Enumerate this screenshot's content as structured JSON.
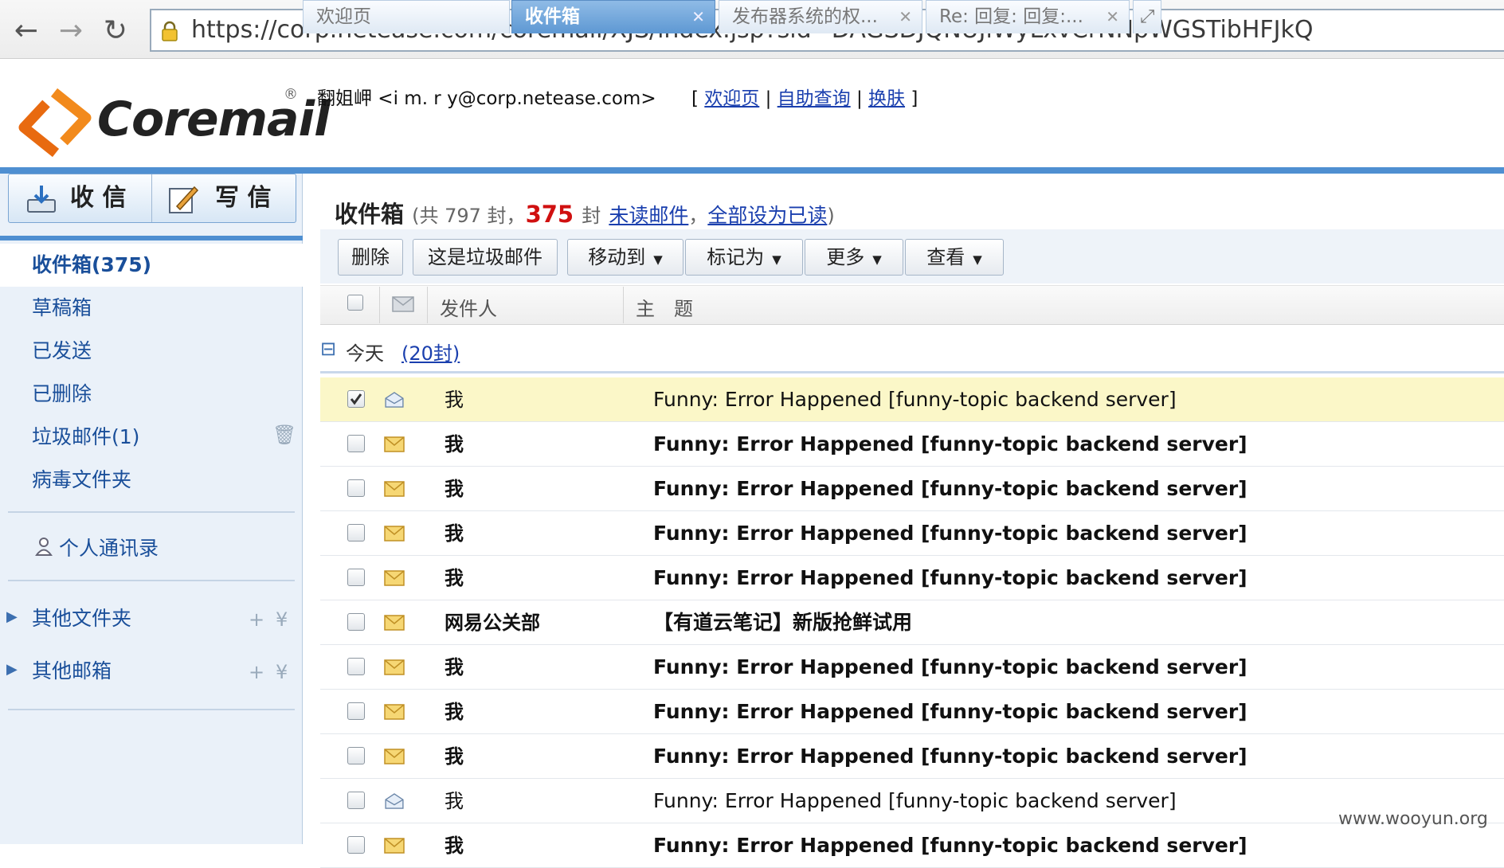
{
  "browser": {
    "url": "https://corp.netease.com/coremail/XJS/index.jsp?sid=DAGSDJQNUJiWyLxvCrNNpWGSTibHFJkQ"
  },
  "header": {
    "logo_text": "Coremail",
    "logo_reg": "®",
    "user": "翻姐岬 <i m. r y@corp.netease.com>",
    "links": {
      "open": "[",
      "welcome": "欢迎页",
      "sep1": "|",
      "selfquery": "自助查询",
      "sep2": "|",
      "skin": "换肤",
      "close": "]"
    }
  },
  "tabs": [
    {
      "label": "欢迎页"
    },
    {
      "label": "收件箱"
    },
    {
      "label": "发布器系统的权..."
    },
    {
      "label": "Re: 回复: 回复:..."
    }
  ],
  "sidebar": {
    "receive_label": "收 信",
    "compose_label": "写 信",
    "folders": [
      {
        "label": "收件箱(375)"
      },
      {
        "label": "草稿箱"
      },
      {
        "label": "已发送"
      },
      {
        "label": "已删除"
      },
      {
        "label": "垃圾邮件(1)"
      },
      {
        "label": "病毒文件夹"
      }
    ],
    "contacts_label": "个人通讯录",
    "other_folders_label": "其他文件夹",
    "other_mailboxes_label": "其他邮箱",
    "add_symbol": "+",
    "more_symbol": "¥"
  },
  "main": {
    "title": "收件箱",
    "summary_prefix": "(共 797 封，",
    "unread_count": "375",
    "summary_mid": "封",
    "unread_link": "未读邮件",
    "comma": "，",
    "mark_all_link": "全部设为已读",
    "summary_suffix": ")",
    "toolbar": {
      "delete": "删除",
      "spam": "这是垃圾邮件",
      "move": "移动到",
      "mark": "标记为",
      "more": "更多",
      "view": "查看"
    },
    "columns": {
      "sender": "发件人",
      "subject": "主　题"
    },
    "group": {
      "toggle": "⊟",
      "label": "今天",
      "count": "(20封)"
    },
    "messages": [
      {
        "sender": "我",
        "subject": "Funny: Error Happened [funny-topic backend server]"
      },
      {
        "sender": "我",
        "subject": "Funny: Error Happened [funny-topic backend server]"
      },
      {
        "sender": "我",
        "subject": "Funny: Error Happened [funny-topic backend server]"
      },
      {
        "sender": "我",
        "subject": "Funny: Error Happened [funny-topic backend server]"
      },
      {
        "sender": "我",
        "subject": "Funny: Error Happened [funny-topic backend server]"
      },
      {
        "sender": "网易公关部",
        "subject": "【有道云笔记】新版抢鲜试用"
      },
      {
        "sender": "我",
        "subject": "Funny: Error Happened [funny-topic backend server]"
      },
      {
        "sender": "我",
        "subject": "Funny: Error Happened [funny-topic backend server]"
      },
      {
        "sender": "我",
        "subject": "Funny: Error Happened [funny-topic backend server]"
      },
      {
        "sender": "我",
        "subject": "Funny: Error Happened [funny-topic backend server]"
      },
      {
        "sender": "我",
        "subject": "Funny: Error Happened [funny-topic backend server]"
      }
    ]
  },
  "watermark": "www.wooyun.org",
  "colors": {
    "accent": "#4f8fd1",
    "unread_count": "#d01010",
    "selected_row": "#fbf7c8",
    "link": "#1a3fae"
  }
}
